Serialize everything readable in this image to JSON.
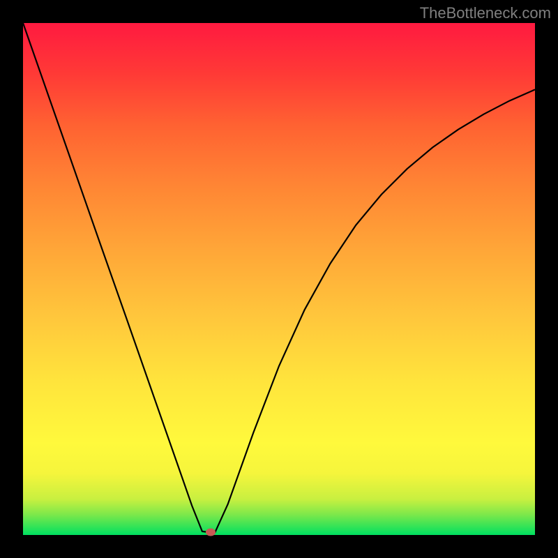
{
  "watermark": "TheBottleneck.com",
  "chart_data": {
    "type": "line",
    "title": "",
    "xlabel": "",
    "ylabel": "",
    "xlim": [
      0,
      100
    ],
    "ylim": [
      0,
      100
    ],
    "series": [
      {
        "name": "curve",
        "x": [
          0,
          5,
          10,
          15,
          20,
          25,
          30,
          33,
          35,
          36.5,
          37.5,
          40,
          45,
          50,
          55,
          60,
          65,
          70,
          75,
          80,
          85,
          90,
          95,
          100
        ],
        "y": [
          100,
          85.7,
          71.4,
          57.1,
          42.9,
          28.6,
          14.3,
          5.7,
          0.7,
          0.5,
          0.5,
          6,
          20,
          33,
          44,
          53,
          60.5,
          66.5,
          71.5,
          75.7,
          79.2,
          82.2,
          84.8,
          87
        ]
      }
    ],
    "marker": {
      "x": 36.6,
      "y": 0.5
    },
    "gradient_stops": [
      {
        "pos": 0,
        "color": "#00e060"
      },
      {
        "pos": 4,
        "color": "#7de84a"
      },
      {
        "pos": 7,
        "color": "#c8f040"
      },
      {
        "pos": 12,
        "color": "#f5f53c"
      },
      {
        "pos": 18,
        "color": "#fff93c"
      },
      {
        "pos": 30,
        "color": "#ffe43c"
      },
      {
        "pos": 42,
        "color": "#ffc83c"
      },
      {
        "pos": 55,
        "color": "#ffa838"
      },
      {
        "pos": 68,
        "color": "#ff8634"
      },
      {
        "pos": 80,
        "color": "#ff6232"
      },
      {
        "pos": 90,
        "color": "#ff3a36"
      },
      {
        "pos": 100,
        "color": "#ff1a40"
      }
    ]
  }
}
